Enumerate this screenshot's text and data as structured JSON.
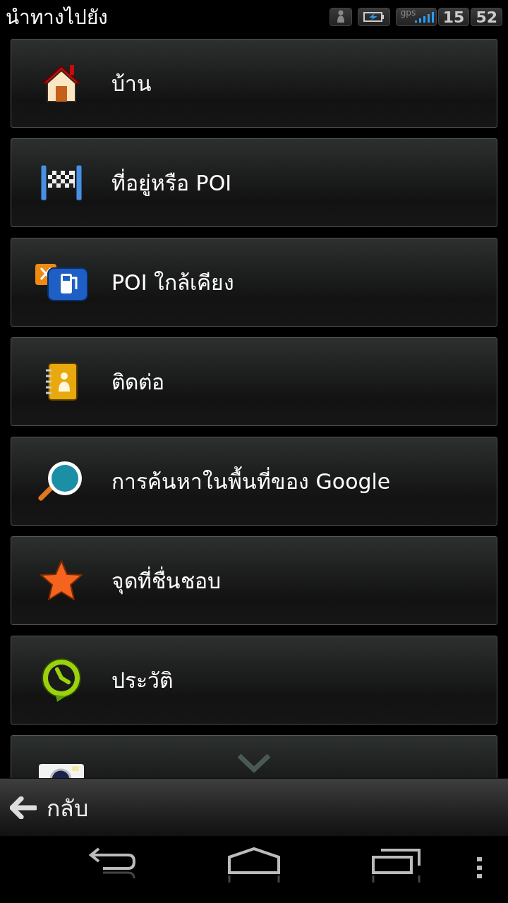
{
  "title": "นำทางไปยัง",
  "status_bar": {
    "gps_label": "gps",
    "hours": "15",
    "minutes": "52"
  },
  "items": [
    {
      "label": "บ้าน",
      "kind": "home"
    },
    {
      "label": "ที่อยู่หรือ POI",
      "kind": "flag"
    },
    {
      "label": "POI ใกล้เคียง",
      "kind": "poi"
    },
    {
      "label": "ติดต่อ",
      "kind": "contacts"
    },
    {
      "label": "การค้นหาในพื้นที่ของ Google",
      "kind": "search"
    },
    {
      "label": "จุดที่ชื่นชอบ",
      "kind": "star"
    },
    {
      "label": "ประวัติ",
      "kind": "history"
    },
    {
      "kind": "camera"
    }
  ],
  "back_bar": {
    "label": "กลับ"
  }
}
